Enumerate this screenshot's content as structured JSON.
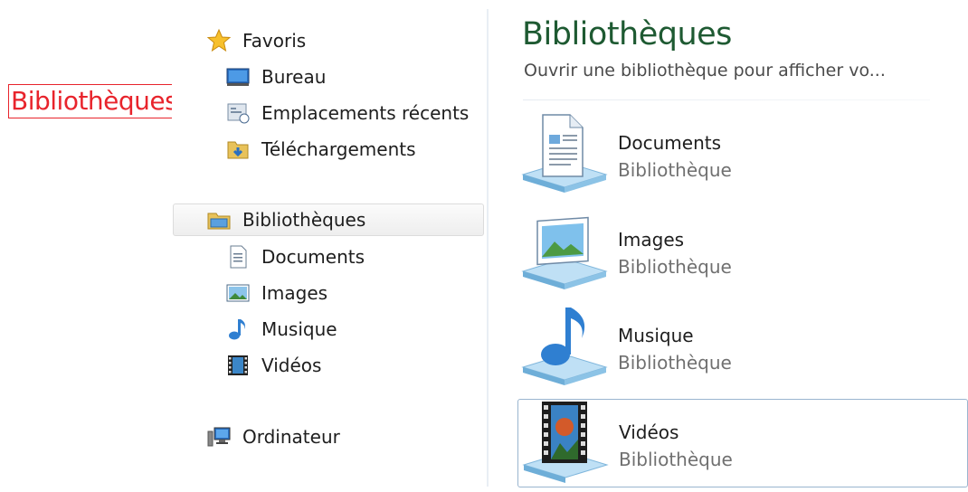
{
  "annotation": {
    "label": "Bibliothèques"
  },
  "nav": {
    "favorites": {
      "label": "Favoris",
      "icon": "star-icon",
      "items": [
        {
          "label": "Bureau",
          "icon": "desktop-icon"
        },
        {
          "label": "Emplacements récents",
          "icon": "recent-places-icon"
        },
        {
          "label": "Téléchargements",
          "icon": "downloads-icon"
        }
      ]
    },
    "libraries": {
      "label": "Bibliothèques",
      "icon": "libraries-icon",
      "items": [
        {
          "label": "Documents",
          "icon": "documents-icon"
        },
        {
          "label": "Images",
          "icon": "pictures-icon"
        },
        {
          "label": "Musique",
          "icon": "music-icon"
        },
        {
          "label": "Vidéos",
          "icon": "videos-icon"
        }
      ]
    },
    "computer": {
      "label": "Ordinateur",
      "icon": "computer-icon"
    }
  },
  "content": {
    "title": "Bibliothèques",
    "subtitle": "Ouvrir une bibliothèque pour afficher vo...",
    "libraries": [
      {
        "name": "Documents",
        "type": "Bibliothèque",
        "icon": "documents-library-icon"
      },
      {
        "name": "Images",
        "type": "Bibliothèque",
        "icon": "images-library-icon"
      },
      {
        "name": "Musique",
        "type": "Bibliothèque",
        "icon": "music-library-icon"
      },
      {
        "name": "Vidéos",
        "type": "Bibliothèque",
        "icon": "videos-library-icon"
      }
    ]
  },
  "colors": {
    "title_green": "#1e5a32",
    "annotation_red": "#e8242c",
    "selection_border": "#9ab5cf"
  }
}
